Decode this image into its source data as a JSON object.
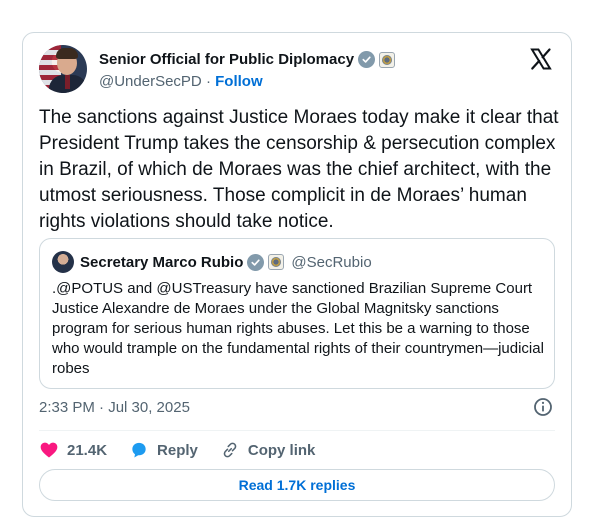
{
  "author": {
    "display_name": "Senior Official for Public Diplomacy",
    "handle": "@UnderSecPD",
    "separator": "·",
    "follow_label": "Follow"
  },
  "tweet": {
    "text": "The sanctions against Justice Moraes today make it clear that President Trump takes the censorship & persecution complex in Brazil, of which de Moraes was the chief architect, with the utmost seriousness. Those complicit in de Moraes’ human rights violations should take notice.",
    "timestamp": "2:33 PM · Jul 30, 2025"
  },
  "quote": {
    "display_name": "Secretary Marco Rubio",
    "handle": "@SecRubio",
    "text": ".@POTUS and @USTreasury have sanctioned Brazilian Supreme Court Justice Alexandre de Moraes under the Global Magnitsky sanctions program for serious human rights abuses. Let this be a warning to those who would trample on the fundamental rights of their countrymen—judicial robes"
  },
  "actions": {
    "likes": "21.4K",
    "reply_label": "Reply",
    "copy_link_label": "Copy link"
  },
  "footer": {
    "read_replies_label": "Read 1.7K replies"
  },
  "colors": {
    "link_blue": "#006fd6",
    "like_pink": "#f91880",
    "reply_blue": "#1d9bf0",
    "secondary_text": "#536471",
    "border": "#cfd9de"
  },
  "icons": [
    "x-logo-icon",
    "verified-badge-icon",
    "government-seal-icon",
    "info-icon",
    "heart-icon",
    "reply-bubble-icon",
    "link-icon"
  ]
}
